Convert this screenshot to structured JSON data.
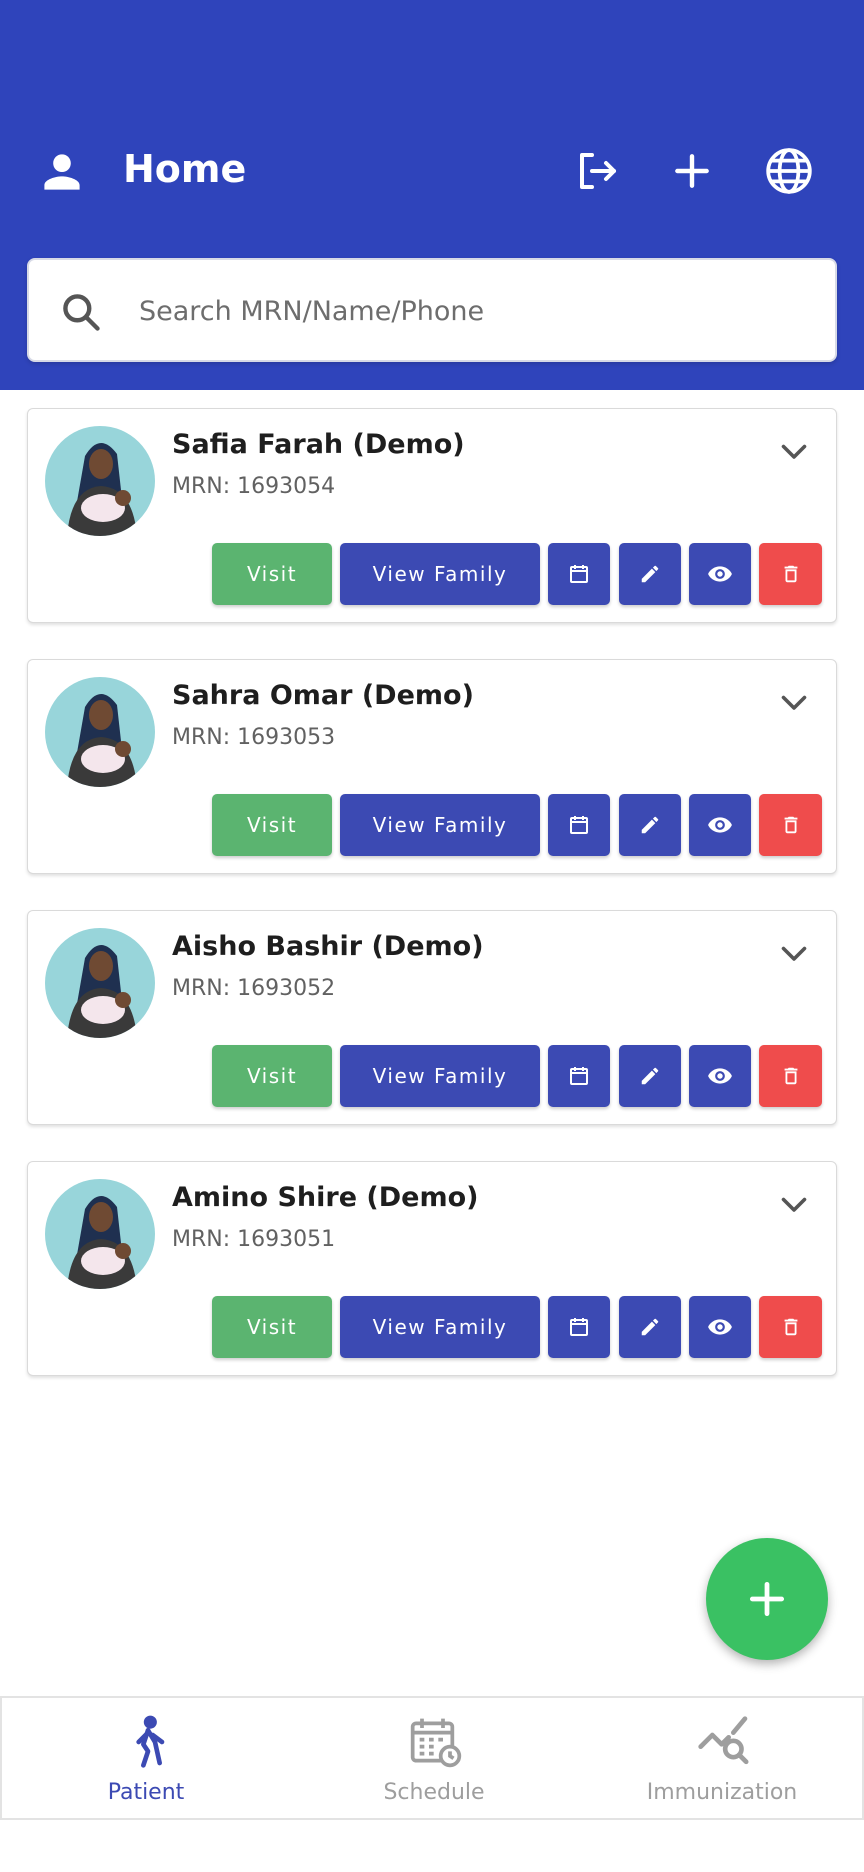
{
  "header": {
    "title": "Home",
    "icons": [
      "person-icon",
      "logout-icon",
      "add-icon",
      "language-icon"
    ]
  },
  "search": {
    "placeholder": "Search MRN/Name/Phone"
  },
  "patients": [
    {
      "name": "Safia Farah (Demo)",
      "mrn_label": "MRN: 1693054"
    },
    {
      "name": "Sahra Omar (Demo)",
      "mrn_label": "MRN: 1693053"
    },
    {
      "name": "Aisho Bashir (Demo)",
      "mrn_label": "MRN: 1693052"
    },
    {
      "name": "Amino Shire (Demo)",
      "mrn_label": "MRN: 1693051"
    }
  ],
  "card_actions": {
    "visit_label": "Visit",
    "view_family_label": "View Family"
  },
  "bottom_nav": [
    {
      "label": "Patient",
      "icon": "walking-person-icon",
      "active": true
    },
    {
      "label": "Schedule",
      "icon": "calendar-clock-icon",
      "active": false
    },
    {
      "label": "Immunization",
      "icon": "chart-search-icon",
      "active": false
    }
  ],
  "colors": {
    "header_bg": "#2f44bb",
    "primary_button": "#3c4ab3",
    "visit_button": "#5bb470",
    "delete_button": "#ef4c4c",
    "fab": "#3ac163",
    "nav_active": "#3c4ab3",
    "nav_inactive": "#9e9e9e"
  }
}
